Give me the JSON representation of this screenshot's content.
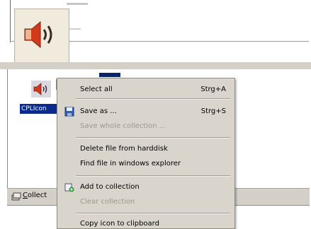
{
  "top_panel": {},
  "list": {
    "selected_label": "CPLIcon"
  },
  "collection_bar": {
    "label_underlined": "C",
    "label_rest": "ollect"
  },
  "context_menu": {
    "select_all": {
      "label": "Select all",
      "shortcut": "Strg+A"
    },
    "save_as": {
      "label": "Save as ...",
      "shortcut": "Strg+S"
    },
    "save_whole_collection": {
      "label": "Save whole collection ..."
    },
    "delete_file": {
      "label": "Delete file from harddisk"
    },
    "find_file": {
      "label": "Find file in windows explorer"
    },
    "add_to_collection": {
      "label": "Add to collection"
    },
    "clear_collection": {
      "label": "Clear collection"
    },
    "copy_icon": {
      "label": "Copy icon to clipboard"
    }
  },
  "colors": {
    "menu_bg": "#d9d5cc",
    "selection_blue": "#0a2a8c",
    "disabled_text": "#9c988f",
    "speaker_red": "#d23a1c"
  },
  "icons": [
    "speaker-icon",
    "cursor-arrow-icon",
    "save-disk-icon",
    "add-collection-icon",
    "collection-icon"
  ]
}
